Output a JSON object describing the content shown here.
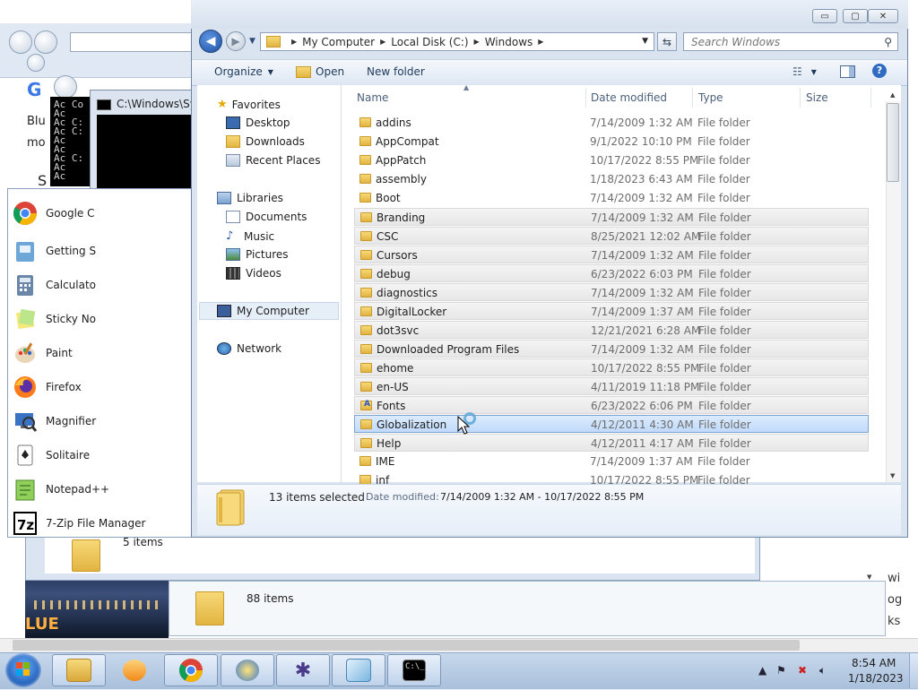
{
  "background": {
    "text_lines": [
      "Blu",
      "mo",
      "S"
    ],
    "cmd_lines": [
      "Ac Co",
      "Ac",
      "Ac C:",
      "Ac C:",
      "Ac",
      "Ac",
      "Ac C:",
      "Ac",
      "Ac"
    ],
    "cmd_title": "C:\\Windows\\Sy",
    "right_text": [
      "wi",
      "og",
      "ks"
    ],
    "bottom_window_1_count": "5 items",
    "bottom_window_2_count": "88 items",
    "image_text": "LUE"
  },
  "start_menu": {
    "items": [
      {
        "label": "Google C",
        "icon": "chrome-icon"
      },
      {
        "label": "Getting S",
        "icon": "getting-started-icon"
      },
      {
        "label": "Calculato",
        "icon": "calculator-icon"
      },
      {
        "label": "Sticky No",
        "icon": "sticky-notes-icon"
      },
      {
        "label": "Paint",
        "icon": "paint-icon"
      },
      {
        "label": "Firefox",
        "icon": "firefox-icon"
      },
      {
        "label": "Magnifier",
        "icon": "magnifier-icon"
      },
      {
        "label": "Solitaire",
        "icon": "solitaire-icon"
      },
      {
        "label": "Notepad++",
        "icon": "notepadpp-icon"
      },
      {
        "label": "7-Zip File Manager",
        "icon": "7zip-icon"
      }
    ]
  },
  "explorer": {
    "window_buttons": {
      "minimize": "▭",
      "maximize": "▢",
      "close": "✕"
    },
    "breadcrumbs": [
      "My Computer",
      "Local Disk (C:)",
      "Windows"
    ],
    "search_placeholder": "Search Windows",
    "toolbar": {
      "organize": "Organize",
      "open": "Open",
      "new_folder": "New folder"
    },
    "nav": {
      "favorites": "Favorites",
      "desktop": "Desktop",
      "downloads": "Downloads",
      "recent_places": "Recent Places",
      "libraries": "Libraries",
      "documents": "Documents",
      "music": "Music",
      "pictures": "Pictures",
      "videos": "Videos",
      "my_computer": "My Computer",
      "network": "Network"
    },
    "columns": {
      "name": "Name",
      "date": "Date modified",
      "type": "Type",
      "size": "Size"
    },
    "rows": [
      {
        "name": "addins",
        "date": "7/14/2009 1:32 AM",
        "type": "File folder",
        "state": "normal"
      },
      {
        "name": "AppCompat",
        "date": "9/1/2022 10:10 PM",
        "type": "File folder",
        "state": "normal"
      },
      {
        "name": "AppPatch",
        "date": "10/17/2022 8:55 PM",
        "type": "File folder",
        "state": "normal"
      },
      {
        "name": "assembly",
        "date": "1/18/2023 6:43 AM",
        "type": "File folder",
        "state": "normal"
      },
      {
        "name": "Boot",
        "date": "7/14/2009 1:32 AM",
        "type": "File folder",
        "state": "normal"
      },
      {
        "name": "Branding",
        "date": "7/14/2009 1:32 AM",
        "type": "File folder",
        "state": "selected"
      },
      {
        "name": "CSC",
        "date": "8/25/2021 12:02 AM",
        "type": "File folder",
        "state": "selected"
      },
      {
        "name": "Cursors",
        "date": "7/14/2009 1:32 AM",
        "type": "File folder",
        "state": "selected"
      },
      {
        "name": "debug",
        "date": "6/23/2022 6:03 PM",
        "type": "File folder",
        "state": "selected"
      },
      {
        "name": "diagnostics",
        "date": "7/14/2009 1:32 AM",
        "type": "File folder",
        "state": "selected"
      },
      {
        "name": "DigitalLocker",
        "date": "7/14/2009 1:37 AM",
        "type": "File folder",
        "state": "selected"
      },
      {
        "name": "dot3svc",
        "date": "12/21/2021 6:28 AM",
        "type": "File folder",
        "state": "selected"
      },
      {
        "name": "Downloaded Program Files",
        "date": "7/14/2009 1:32 AM",
        "type": "File folder",
        "state": "selected"
      },
      {
        "name": "ehome",
        "date": "10/17/2022 8:55 PM",
        "type": "File folder",
        "state": "selected"
      },
      {
        "name": "en-US",
        "date": "4/11/2019 11:18 PM",
        "type": "File folder",
        "state": "selected"
      },
      {
        "name": "Fonts",
        "date": "6/23/2022 6:06 PM",
        "type": "File folder",
        "state": "selected"
      },
      {
        "name": "Globalization",
        "date": "4/12/2011 4:30 AM",
        "type": "File folder",
        "state": "focused"
      },
      {
        "name": "Help",
        "date": "4/12/2011 4:17 AM",
        "type": "File folder",
        "state": "selected"
      },
      {
        "name": "IME",
        "date": "7/14/2009 1:37 AM",
        "type": "File folder",
        "state": "normal"
      },
      {
        "name": "inf",
        "date": "10/17/2022 8:55 PM",
        "type": "File folder",
        "state": "normal"
      }
    ],
    "details": {
      "count": "13 items selected",
      "date_label": "Date modified:",
      "date_value": "7/14/2009 1:32 AM - 10/17/2022 8:55 PM"
    }
  },
  "taskbar": {
    "apps": [
      "explorer-icon",
      "media-player-icon",
      "chrome-icon",
      "control-panel-icon",
      "spider-icon",
      "notepad-icon",
      "cmd-icon"
    ],
    "time": "8:54 AM",
    "date": "1/18/2023"
  }
}
